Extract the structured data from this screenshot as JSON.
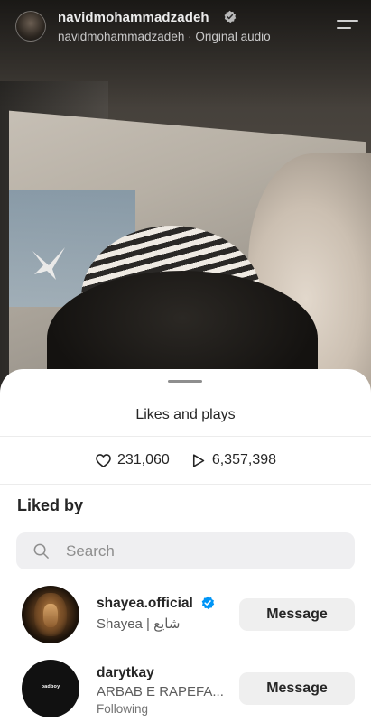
{
  "header": {
    "username": "navidmohammadzadeh",
    "audio_label": "navidmohammadzadeh · Original audio",
    "avatar_icon": "profile-avatar",
    "menu_icon": "menu-icon"
  },
  "sheet": {
    "title": "Likes and plays",
    "likes_count": "231,060",
    "plays_count": "6,357,398",
    "liked_by_heading": "Liked by",
    "search_placeholder": "Search"
  },
  "users": [
    {
      "username": "shayea.official",
      "display_name": "Shayea | شایع",
      "verified": true,
      "status": "",
      "button_label": "Message"
    },
    {
      "username": "darytkay",
      "display_name": "ARBAB E RAPEFA...",
      "verified": false,
      "status": "Following",
      "button_label": "Message",
      "avatar_text": "badboy"
    }
  ],
  "colors": {
    "verified_blue": "#0095f6",
    "sheet_bg": "#ffffff",
    "button_bg": "#efefef",
    "search_bg": "#efeff1"
  }
}
